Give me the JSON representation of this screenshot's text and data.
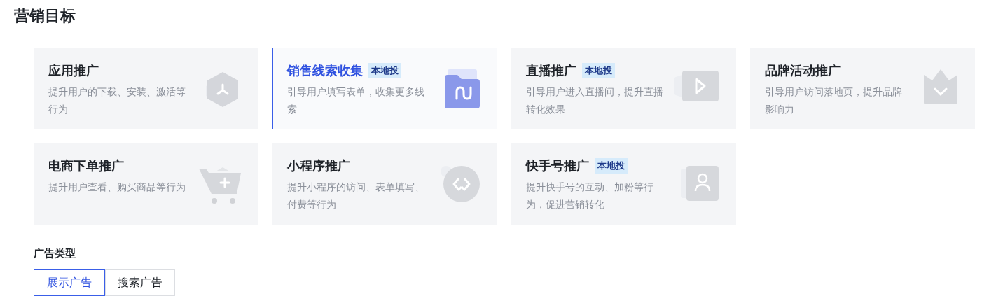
{
  "page_title": "营销目标",
  "goals": [
    {
      "title": "应用推广",
      "description": "提升用户的下载、安装、激活等行为",
      "selected": false
    },
    {
      "title": "销售线索收集",
      "tag": "本地投",
      "description": "引导用户填写表单，收集更多线索",
      "selected": true
    },
    {
      "title": "直播推广",
      "tag": "本地投",
      "description": "引导用户进入直播间，提升直播转化效果",
      "selected": false
    },
    {
      "title": "品牌活动推广",
      "description": "引导用户访问落地页，提升品牌影响力",
      "selected": false
    },
    {
      "title": "电商下单推广",
      "description": "提升用户查看、购买商品等行为",
      "selected": false
    },
    {
      "title": "小程序推广",
      "description": "提升小程序的访问、表单填写、付费等行为",
      "selected": false
    },
    {
      "title": "快手号推广",
      "tag": "本地投",
      "description": "提升快手号的互动、加粉等行为，促进营销转化",
      "selected": false
    }
  ],
  "ad_type": {
    "label": "广告类型",
    "options": [
      {
        "label": "展示广告",
        "selected": true
      },
      {
        "label": "搜索广告",
        "selected": false
      }
    ]
  }
}
